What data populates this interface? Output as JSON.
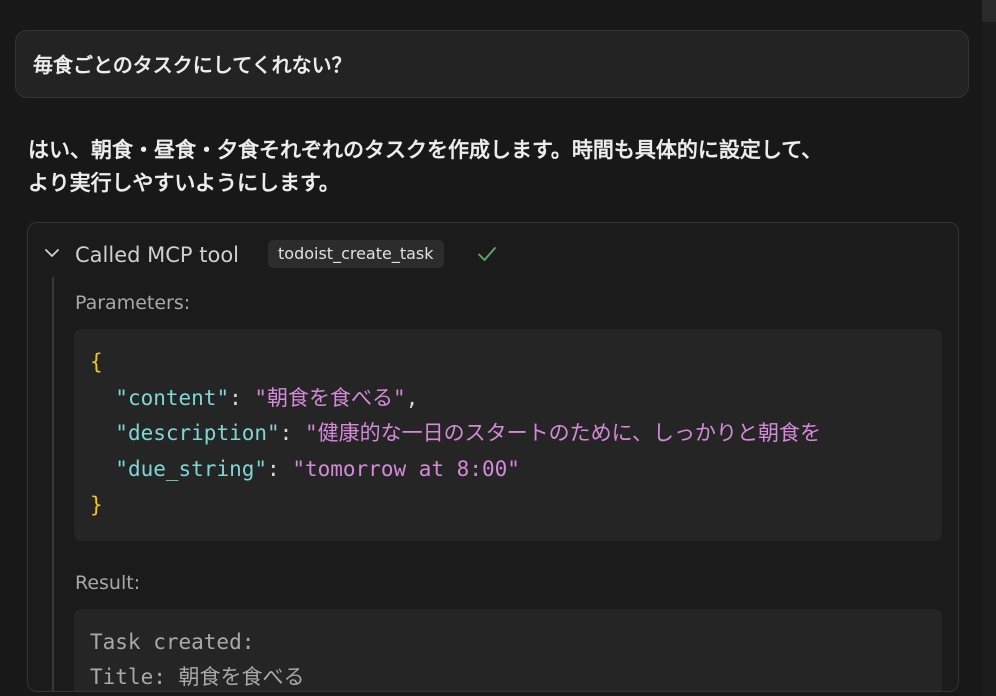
{
  "user_message": "毎食ごとのタスクにしてくれない？",
  "assistant_message": {
    "line1": "はい、朝食・昼食・夕食それぞれのタスクを作成します。時間も具体的に設定して、",
    "line2": "より実行しやすいようにします。"
  },
  "tool_call": {
    "status_label": "Called MCP tool",
    "tool_name": "todoist_create_task",
    "status_icon": "check-icon",
    "parameters_label": "Parameters:",
    "params": {
      "open_brace": "{",
      "close_brace": "}",
      "content_key": "\"content\"",
      "content_value": "\"朝食を食べる\"",
      "description_key": "\"description\"",
      "description_value": "\"健康的な一日のスタートのために、しっかりと朝食を",
      "due_key": "\"due_string\"",
      "due_value": "\"tomorrow at 8:00\""
    },
    "result_label": "Result:",
    "result": {
      "line1": "Task created:",
      "line2": "Title: 朝食を食べる"
    }
  },
  "colors": {
    "background": "#181818",
    "brace": "#f5c518",
    "json_key": "#7fd6d6",
    "json_string": "#d48ad8",
    "check": "#5fae6a"
  }
}
